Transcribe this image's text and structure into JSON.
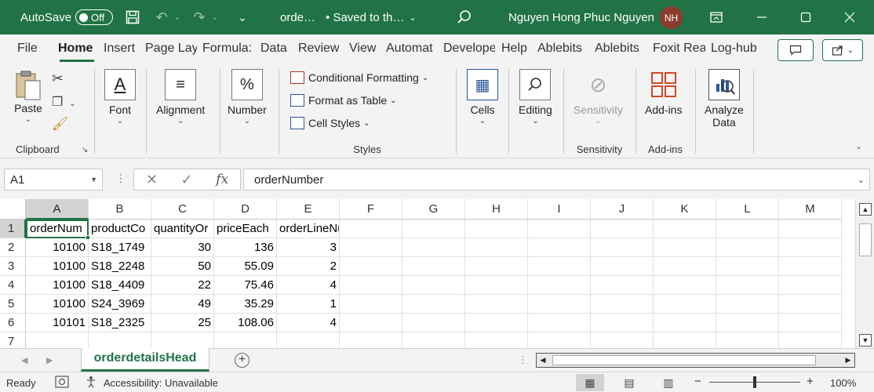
{
  "titlebar": {
    "autosave_label": "AutoSave",
    "autosave_state": "Off",
    "doc_name": "orde…",
    "save_status": "• Saved to th…",
    "user_name": "Nguyen Hong Phuc Nguyen",
    "user_initials": "NH"
  },
  "tabs": [
    "File",
    "Home",
    "Insert",
    "Page Lay",
    "Formula:",
    "Data",
    "Review",
    "View",
    "Automat",
    "Develope",
    "Help",
    "Ablebits",
    "Ablebits",
    "Foxit Rea",
    "Log-hub"
  ],
  "ribbon": {
    "clipboard": {
      "paste": "Paste",
      "group": "Clipboard"
    },
    "font": {
      "label": "Font"
    },
    "alignment": {
      "label": "Alignment"
    },
    "number": {
      "label": "Number"
    },
    "styles": {
      "conditional": "Conditional Formatting",
      "format_table": "Format as Table",
      "cell_styles": "Cell Styles",
      "group": "Styles"
    },
    "cells": {
      "label": "Cells"
    },
    "editing": {
      "label": "Editing"
    },
    "sensitivity": {
      "label": "Sensitivity",
      "group": "Sensitivity"
    },
    "addins": {
      "label": "Add-ins",
      "group": "Add-ins"
    },
    "analyze": {
      "line1": "Analyze",
      "line2": "Data"
    }
  },
  "formula_bar": {
    "name_box": "A1",
    "fx": "fx",
    "content": "orderNumber"
  },
  "grid": {
    "columns": [
      "A",
      "B",
      "C",
      "D",
      "E",
      "F",
      "G",
      "H",
      "I",
      "J",
      "K",
      "L",
      "M"
    ],
    "rows": [
      "1",
      "2",
      "3",
      "4",
      "5",
      "6",
      "7"
    ],
    "cells": [
      [
        "orderNum",
        "productCo",
        "quantityOr",
        "priceEach",
        "orderLineNumber"
      ],
      [
        "10100",
        "S18_1749",
        "30",
        "136",
        "3"
      ],
      [
        "10100",
        "S18_2248",
        "50",
        "55.09",
        "2"
      ],
      [
        "10100",
        "S18_4409",
        "22",
        "75.46",
        "4"
      ],
      [
        "10100",
        "S24_3969",
        "49",
        "35.29",
        "1"
      ],
      [
        "10101",
        "S18_2325",
        "25",
        "108.06",
        "4"
      ]
    ]
  },
  "sheet": {
    "active_tab": "orderdetailsHead"
  },
  "status": {
    "ready": "Ready",
    "accessibility": "Accessibility: Unavailable",
    "zoom": "100%",
    "zoom_fraction": 0.5
  },
  "accent_color": "#217346"
}
